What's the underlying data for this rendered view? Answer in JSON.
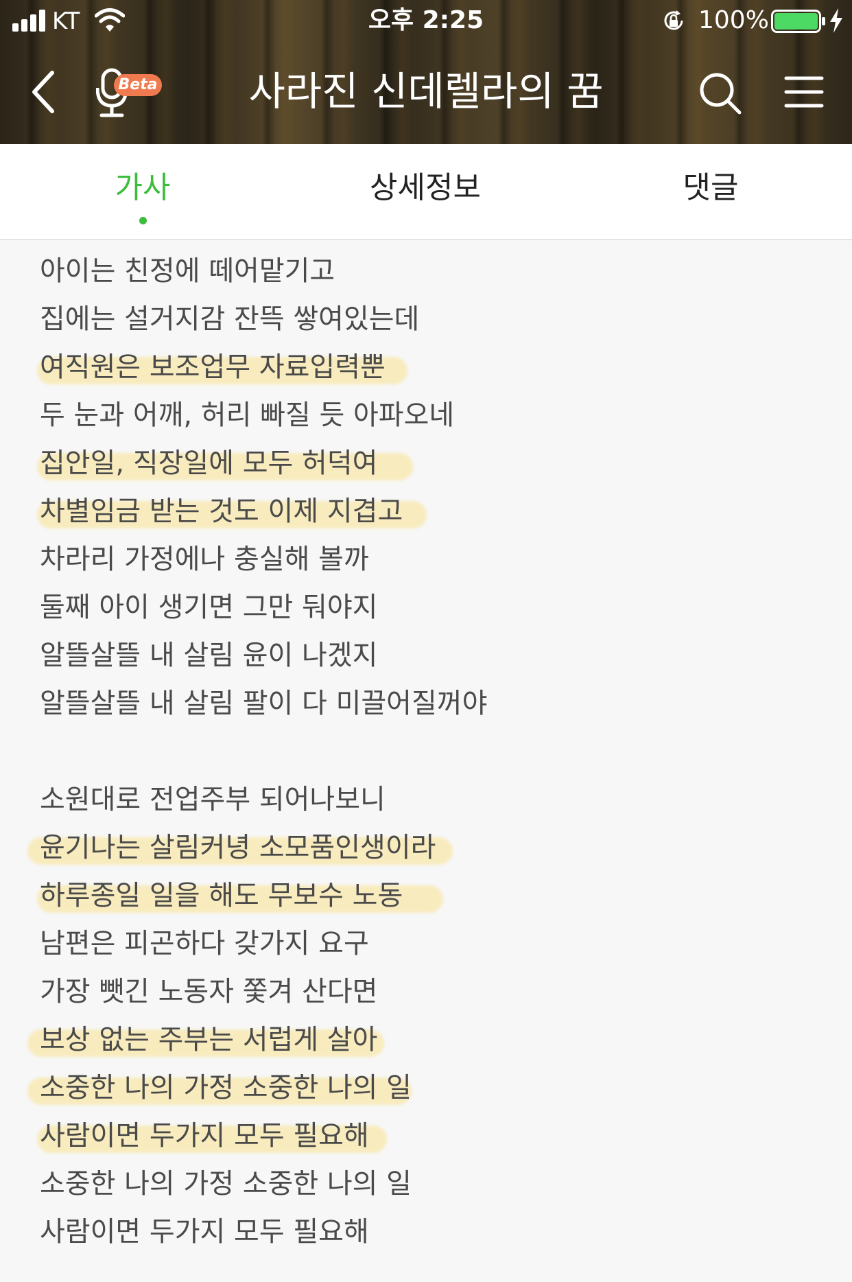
{
  "status_bar": {
    "carrier": "KT",
    "time": "오후 2:25",
    "battery_percent": "100%",
    "battery_level": 1.0
  },
  "nav": {
    "title": "사라진 신데렐라의 꿈",
    "mic_badge": "Beta"
  },
  "tabs": [
    {
      "label": "가사",
      "active": true
    },
    {
      "label": "상세정보",
      "active": false
    },
    {
      "label": "댓글",
      "active": false
    }
  ],
  "colors": {
    "accent_green": "#3cbd3c",
    "highlight_yellow": "#fadc6e",
    "beta_badge": "#f07a4f"
  },
  "lyrics": [
    {
      "text": "아이는 친정에 떼어맡기고",
      "highlighted": false
    },
    {
      "text": "집에는 설거지감 잔뜩 쌓여있는데",
      "highlighted": false
    },
    {
      "text": "여직원은 보조업무 자료입력뿐",
      "highlighted": true
    },
    {
      "text": "두 눈과 어깨, 허리 빠질 듯 아파오네",
      "highlighted": false
    },
    {
      "text": "집안일, 직장일에 모두 허덕여",
      "highlighted": true
    },
    {
      "text": "차별임금 받는 것도 이제 지겹고",
      "highlighted": true
    },
    {
      "text": "차라리 가정에나 충실해 볼까",
      "highlighted": false
    },
    {
      "text": "둘째 아이 생기면 그만 둬야지",
      "highlighted": false
    },
    {
      "text": "알뜰살뜰 내 살림 윤이 나겠지",
      "highlighted": false
    },
    {
      "text": "알뜰살뜰 내 살림 팔이 다 미끌어질꺼야",
      "highlighted": false
    },
    {
      "text": "소원대로 전업주부 되어나보니",
      "highlighted": false
    },
    {
      "text": "윤기나는 살림커녕 소모품인생이라",
      "highlighted": true
    },
    {
      "text": "하루종일 일을 해도 무보수 노동",
      "highlighted": true
    },
    {
      "text": "남편은 피곤하다 갖가지 요구",
      "highlighted": false
    },
    {
      "text": "가장 뺏긴 노동자 쫓겨 산다면",
      "highlighted": false
    },
    {
      "text": "보상 없는 주부는 서럽게 살아",
      "highlighted": true
    },
    {
      "text": "소중한 나의 가정 소중한 나의 일",
      "highlighted": true
    },
    {
      "text": "사람이면 두가지 모두 필요해",
      "highlighted": true
    },
    {
      "text": "소중한 나의 가정 소중한 나의 일",
      "highlighted": false
    },
    {
      "text": "사람이면 두가지 모두 필요해",
      "highlighted": false
    }
  ]
}
